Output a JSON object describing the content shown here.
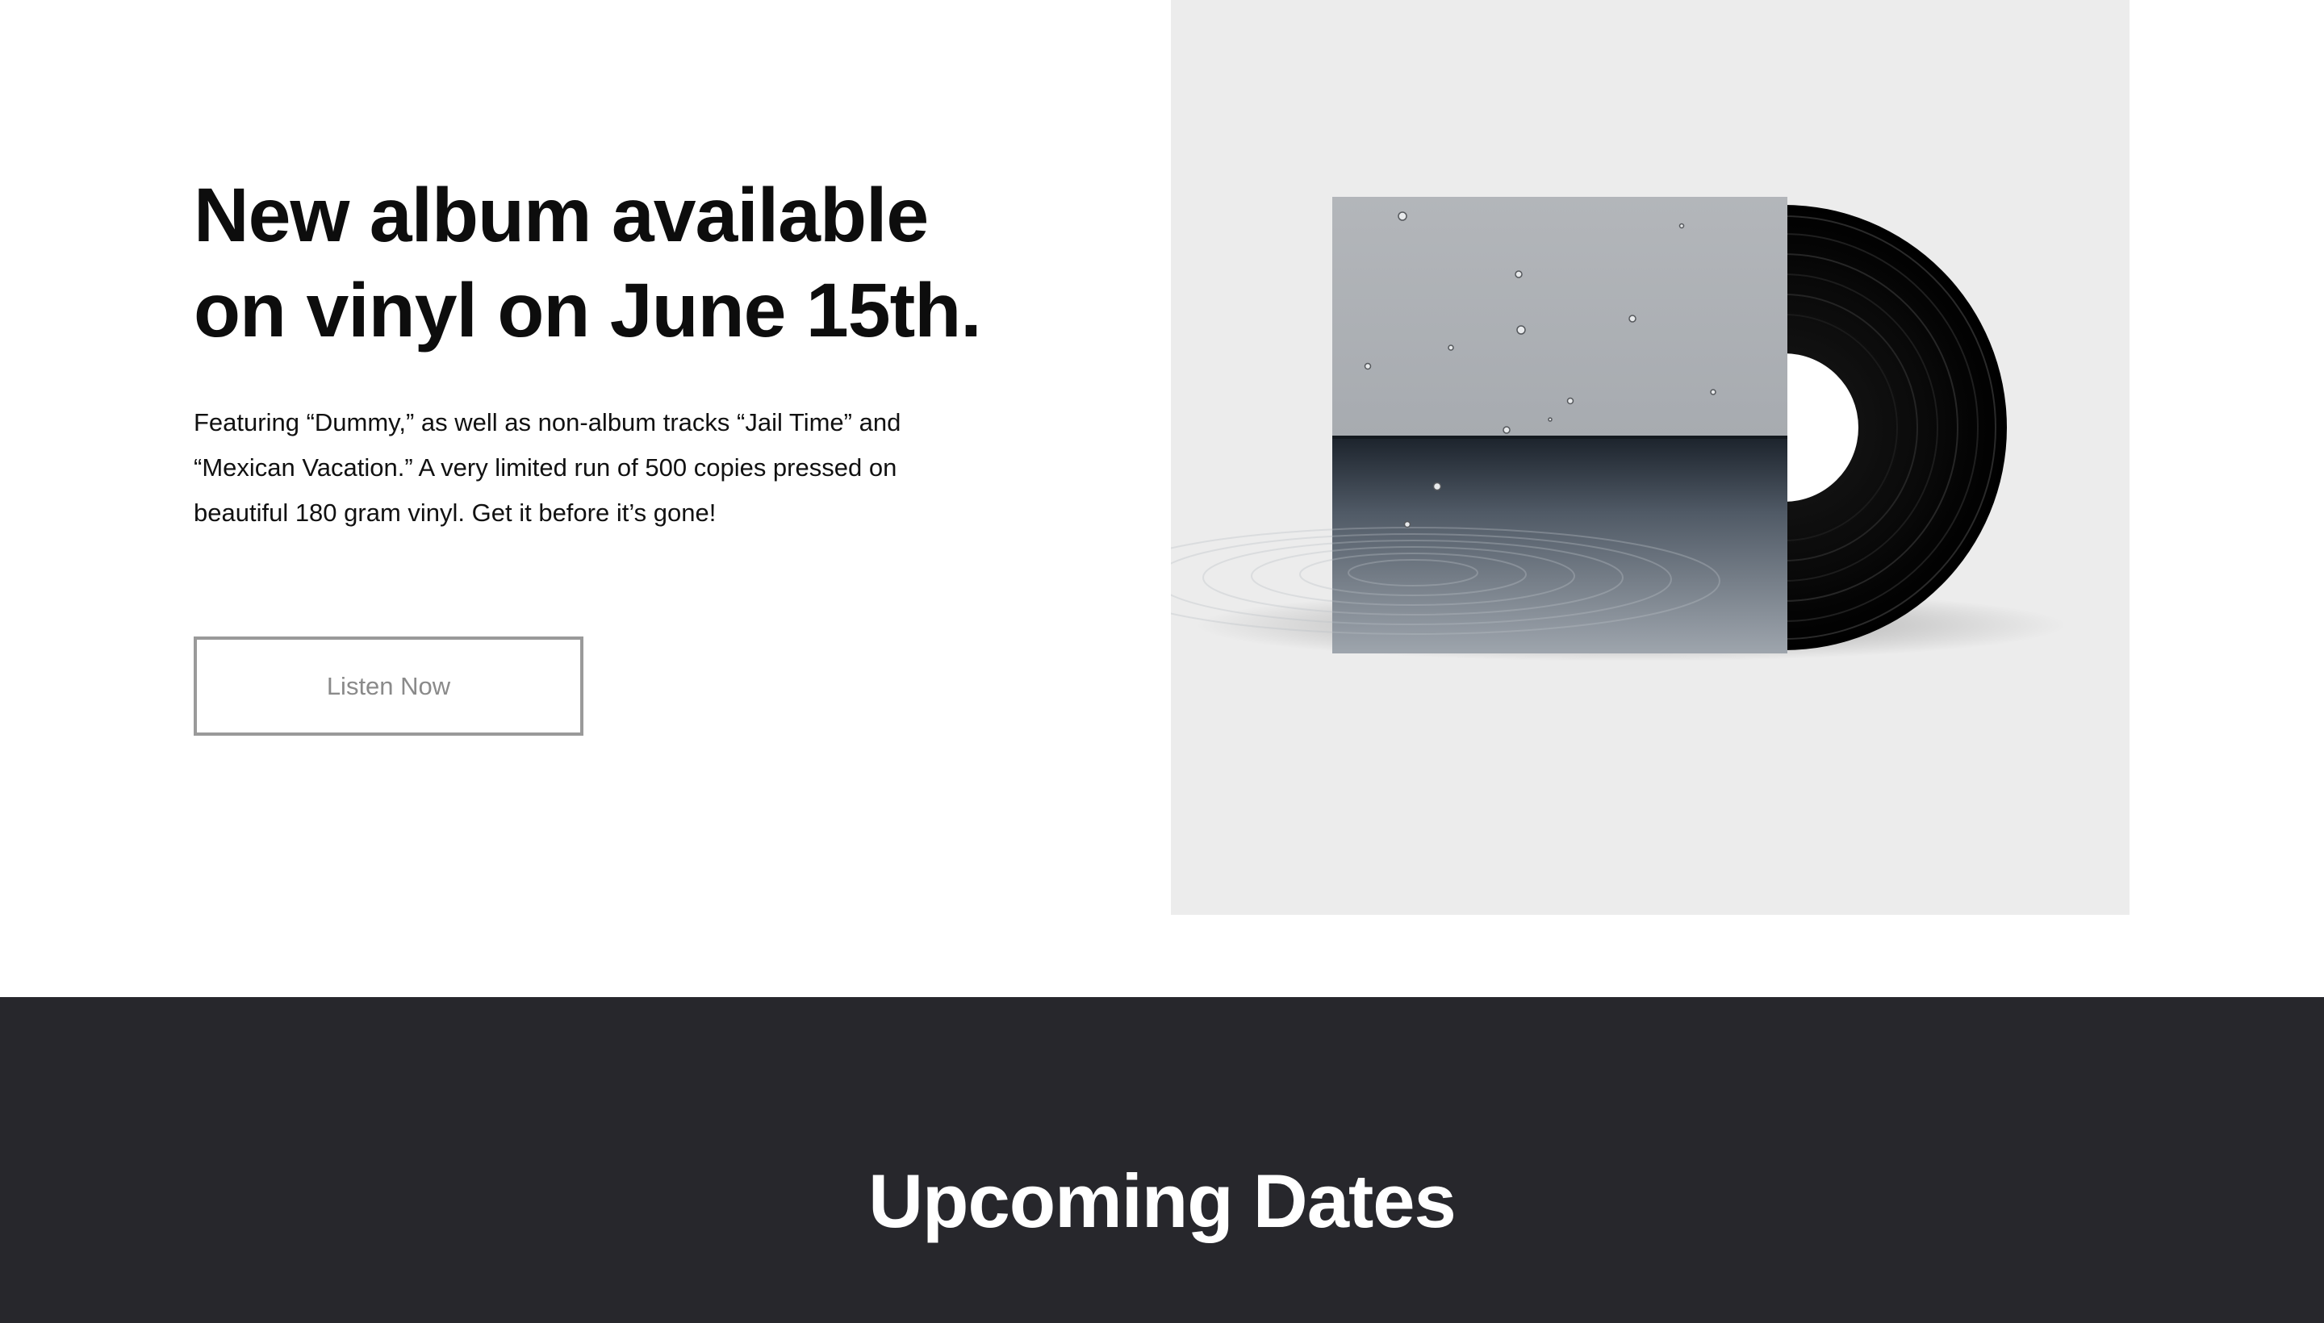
{
  "hero": {
    "headline_line1": "New album available",
    "headline_line2": "on vinyl on June 15th.",
    "description_line1": "Featuring “Dummy,” as well as non-album tracks “Jail Time” and",
    "description_line2": "“Mexican Vacation.” A very limited run of 500 copies pressed on",
    "description_line3": "beautiful 180 gram vinyl. Get it before it’s gone!",
    "cta_label": "Listen Now"
  },
  "album_visual": {
    "panel_color": "#ececec",
    "sleeve_top_color": "#b6b9bd",
    "sleeve_water_color": "#3a4350",
    "vinyl_color": "#050505",
    "label_color": "#ffffff"
  },
  "dates_section": {
    "title": "Upcoming Dates",
    "background": "#27272c"
  }
}
